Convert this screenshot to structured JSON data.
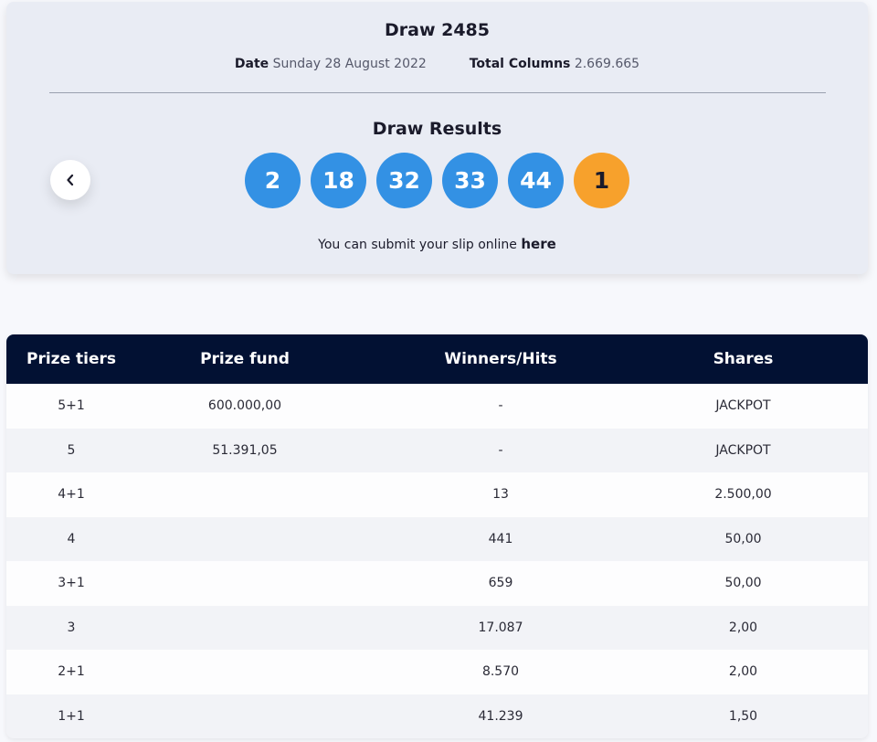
{
  "draw": {
    "title": "Draw 2485",
    "date_label": "Date",
    "date_value": "Sunday 28 August 2022",
    "columns_label": "Total Columns",
    "columns_value": "2.669.665"
  },
  "results": {
    "title": "Draw Results",
    "numbers": [
      "2",
      "18",
      "32",
      "33",
      "44"
    ],
    "bonus": "1",
    "submit_text": "You can submit your slip online",
    "submit_link": "here",
    "ball_color": "#3391e4",
    "bonus_color": "#f7a12c"
  },
  "nav": {
    "back_icon": "chevron-left-icon"
  },
  "table": {
    "headers": [
      "Prize tiers",
      "Prize fund",
      "Winners/Hits",
      "Shares"
    ],
    "rows": [
      [
        "5+1",
        "600.000,00",
        "-",
        "JACKPOT"
      ],
      [
        "5",
        "51.391,05",
        "-",
        "JACKPOT"
      ],
      [
        "4+1",
        "",
        "13",
        "2.500,00"
      ],
      [
        "4",
        "",
        "441",
        "50,00"
      ],
      [
        "3+1",
        "",
        "659",
        "50,00"
      ],
      [
        "3",
        "",
        "17.087",
        "2,00"
      ],
      [
        "2+1",
        "",
        "8.570",
        "2,00"
      ],
      [
        "1+1",
        "",
        "41.239",
        "1,50"
      ]
    ],
    "header_bg": "#021133"
  }
}
